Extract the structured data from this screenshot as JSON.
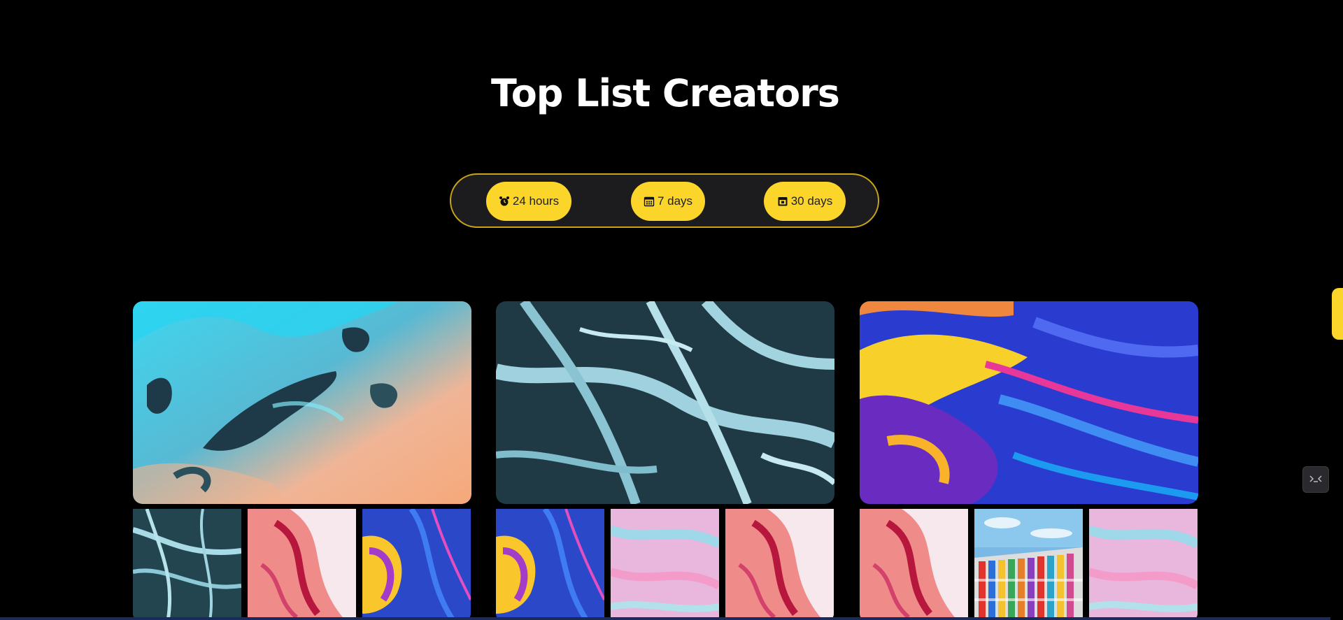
{
  "page": {
    "title": "Top List Creators"
  },
  "filters": [
    {
      "label": "24 hours",
      "icon": "alarm-clock-icon"
    },
    {
      "label": "7 days",
      "icon": "calendar-icon"
    },
    {
      "label": "30 days",
      "icon": "calendar-date-icon"
    }
  ],
  "colors": {
    "background": "#000000",
    "accent": "#fcd52a",
    "filter_bar_bg": "#1c1c1e",
    "filter_bar_border": "#c8a418"
  },
  "collections": [
    {
      "hero": "blue-ice-peach-abstract",
      "thumbs": [
        "teal-river-aerial",
        "pink-red-fluid",
        "purple-yellow-fluid"
      ]
    },
    {
      "hero": "teal-river-aerial",
      "thumbs": [
        "purple-yellow-fluid",
        "pastel-pink-blue-fluid",
        "pink-red-fluid"
      ]
    },
    {
      "hero": "purple-yellow-fluid",
      "thumbs": [
        "pink-red-fluid",
        "colorful-building-facade",
        "pastel-pink-blue-fluid"
      ]
    }
  ],
  "widgets": {
    "floating_button_icon": "terminal-icon"
  }
}
